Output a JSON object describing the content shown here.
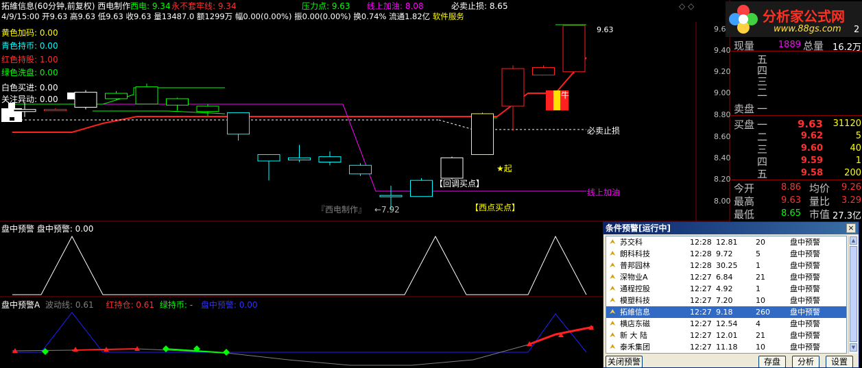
{
  "colors": {
    "red": "#ff3030",
    "green": "#00ff00",
    "cyan": "#00ffff",
    "magenta": "#ff00ff",
    "yellow": "#ffff00",
    "white": "#ffffff",
    "gray": "#808080",
    "blue": "#3030ff"
  },
  "header": {
    "stock_title": "拓維信息(60分钟,前复权)",
    "indicator_name": "西电制作",
    "items": [
      {
        "label": "西电: 9.34",
        "color": "#00ff00"
      },
      {
        "label": "永不套牢线: 9.34",
        "color": "#ff3030"
      },
      {
        "label": "压力点: 9.63",
        "color": "#00ff00"
      },
      {
        "label": "线上加油: 8.08",
        "color": "#ff00ff"
      },
      {
        "label": "必卖止损: 8.65",
        "color": "#ffffff"
      }
    ],
    "quote_line": "4/9/15:00 开9.63 高9.63 低9.63 收9.63 量13487.0 额1299万 幅0.00(0.00%) 振0.00(0.00%) 换0.74% 流通1.82亿",
    "software": "软件服务"
  },
  "legend": [
    {
      "label": "黄色加码: 0.00",
      "color": "#ffff00"
    },
    {
      "label": "青色持币: 0.00",
      "color": "#00ffff"
    },
    {
      "label": "红色持股: 1.00",
      "color": "#ff3030"
    },
    {
      "label": "绿色洗盘: 0.00",
      "color": "#00ff00"
    },
    {
      "label": "白色买进: 0.00",
      "color": "#ffffff"
    },
    {
      "label": "关注异动: 0.00",
      "color": "#ffffff"
    }
  ],
  "annotations": {
    "high_price": "9.63",
    "stop_loss": "必卖止损",
    "line_oil": "线上加油",
    "low_price": "←7.92",
    "watermark": "『西电制作』",
    "pullback": "【回调买点】",
    "west_buy": "【西点买点】",
    "start": "★起",
    "bull": "牛"
  },
  "price_axis": [
    "9.60",
    "9.40",
    "9.20",
    "9.00",
    "8.80",
    "8.60",
    "8.40",
    "8.20",
    "8.00"
  ],
  "panel2": {
    "title": "盘中预警  盘中预警: 0.00"
  },
  "panel3": {
    "title": "盘中预警A",
    "items": [
      {
        "label": "波动线: 0.61",
        "color": "#808080"
      },
      {
        "label": "红持仓: 0.61",
        "color": "#ff3030"
      },
      {
        "label": "绿持币: -",
        "color": "#00ff00"
      },
      {
        "label": "盘中预警: 0.00",
        "color": "#3030ff"
      }
    ]
  },
  "brand": {
    "name": "分析家公式网",
    "url": "www.88gs.com",
    "corner": "2"
  },
  "quote_panel": {
    "now_vol_label": "现量",
    "now_vol": "1889",
    "total_vol_label": "总量",
    "total_vol": "16.2万",
    "sell_label": "卖盘",
    "sell_levels": [
      "五",
      "四",
      "三",
      "二",
      "一"
    ],
    "buy_label": "买盘",
    "buy_levels": [
      {
        "level": "一",
        "price": "9.63",
        "vol": "31120"
      },
      {
        "level": "二",
        "price": "9.62",
        "vol": "5"
      },
      {
        "level": "三",
        "price": "9.60",
        "vol": "40"
      },
      {
        "level": "四",
        "price": "9.59",
        "vol": "1"
      },
      {
        "level": "五",
        "price": "9.58",
        "vol": "200"
      }
    ],
    "stats": [
      {
        "l1": "今开",
        "v1": "8.86",
        "l2": "均价",
        "v2": "9.26"
      },
      {
        "l1": "最高",
        "v1": "9.63",
        "l2": "量比",
        "v2": "3.29"
      },
      {
        "l1": "最低",
        "v1": "8.65",
        "l2": "市值",
        "v2": "27.3亿"
      }
    ]
  },
  "alert_window": {
    "title": "条件预警[运行中]",
    "close": "×",
    "rows": [
      {
        "name": "苏交科",
        "time": "12:28",
        "price": "12.81",
        "vol": "20",
        "type": "盘中预警"
      },
      {
        "name": "朗科科技",
        "time": "12:28",
        "price": "9.72",
        "vol": "5",
        "type": "盘中预警"
      },
      {
        "name": "普邦园林",
        "time": "12:28",
        "price": "30.25",
        "vol": "1",
        "type": "盘中预警"
      },
      {
        "name": "深物业A",
        "time": "12:27",
        "price": "6.84",
        "vol": "21",
        "type": "盘中预警"
      },
      {
        "name": "通程控股",
        "time": "12:27",
        "price": "4.92",
        "vol": "1",
        "type": "盘中预警"
      },
      {
        "name": "模塑科技",
        "time": "12:27",
        "price": "7.20",
        "vol": "10",
        "type": "盘中预警"
      },
      {
        "name": "拓維信息",
        "time": "12:27",
        "price": "9.18",
        "vol": "260",
        "type": "盘中预警"
      },
      {
        "name": "横店东磁",
        "time": "12:27",
        "price": "12.54",
        "vol": "4",
        "type": "盘中预警"
      },
      {
        "name": "新 大 陆",
        "time": "12:27",
        "price": "12.01",
        "vol": "21",
        "type": "盘中预警"
      },
      {
        "name": "泰禾集团",
        "time": "12:27",
        "price": "11.18",
        "vol": "10",
        "type": "盘中预警"
      }
    ],
    "selected_index": 6,
    "buttons": [
      "关闭预警",
      "存盘",
      "分析",
      "设置"
    ]
  },
  "chart_data": {
    "type": "candlestick",
    "ylim": [
      7.9,
      9.7
    ],
    "candles": [
      {
        "o": 8.83,
        "c": 8.85,
        "h": 8.92,
        "l": 8.78
      },
      {
        "o": 8.84,
        "c": 8.85,
        "h": 8.86,
        "l": 8.84
      },
      {
        "o": 8.87,
        "c": 9.01,
        "h": 9.03,
        "l": 8.85
      },
      {
        "o": 8.95,
        "c": 9.0,
        "h": 9.02,
        "l": 8.94
      },
      {
        "o": 8.9,
        "c": 9.06,
        "h": 9.09,
        "l": 8.9
      },
      {
        "o": 8.89,
        "c": 8.95,
        "h": 8.96,
        "l": 8.84
      },
      {
        "o": 8.83,
        "c": 8.88,
        "h": 8.9,
        "l": 8.79
      },
      {
        "o": 8.82,
        "c": 8.62,
        "h": 8.82,
        "l": 8.56
      },
      {
        "o": 8.43,
        "c": 8.37,
        "h": 8.43,
        "l": 8.19
      },
      {
        "o": 8.4,
        "c": 8.38,
        "h": 8.52,
        "l": 8.36
      },
      {
        "o": 8.36,
        "c": 8.41,
        "h": 8.46,
        "l": 8.33
      },
      {
        "o": 8.33,
        "c": 8.25,
        "h": 8.35,
        "l": 8.23
      },
      {
        "o": 8.05,
        "c": 8.05,
        "h": 8.14,
        "l": 7.92
      },
      {
        "o": 8.04,
        "c": 8.19,
        "h": 8.21,
        "l": 8.04
      },
      {
        "o": 8.21,
        "c": 8.4,
        "h": 8.41,
        "l": 8.2
      },
      {
        "o": 8.43,
        "c": 8.81,
        "h": 8.82,
        "l": 8.43
      },
      {
        "o": 9.23,
        "c": 8.88,
        "h": 9.26,
        "l": 8.65
      },
      {
        "o": 9.17,
        "c": 9.24,
        "h": 9.26,
        "l": 9.17
      },
      {
        "o": 9.2,
        "c": 9.63,
        "h": 9.63,
        "l": 9.18
      }
    ]
  }
}
